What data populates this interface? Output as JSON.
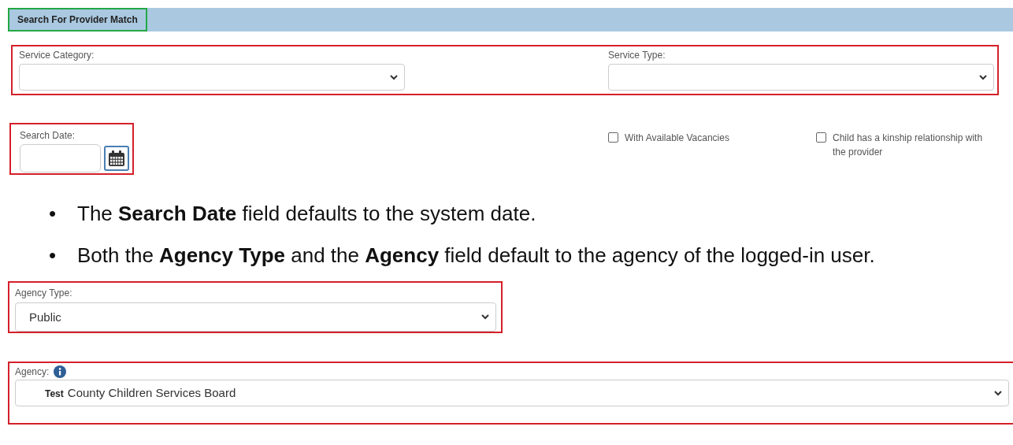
{
  "header": {
    "title": "Search For Provider Match"
  },
  "service_fields": [
    {
      "label": "Service Category:"
    },
    {
      "label": "Service Type:"
    }
  ],
  "search_date": {
    "label": "Search Date:"
  },
  "checkboxes": [
    {
      "label": "With Available Vacancies",
      "checked": false
    },
    {
      "label": "Child has a kinship relationship with the provider",
      "checked": false
    }
  ],
  "notes": [
    {
      "bullet": "•",
      "text": "The **Search Date** field defaults to the system date."
    },
    {
      "bullet": "•",
      "text": "Both the **Agency Type** and the **Agency** field default to the agency of the logged-in user."
    }
  ],
  "agency_type": {
    "label": "Agency Type:",
    "value": "Public"
  },
  "agency": {
    "label": "Agency:",
    "prefix": "Test",
    "value": "County Children Services Board"
  }
}
